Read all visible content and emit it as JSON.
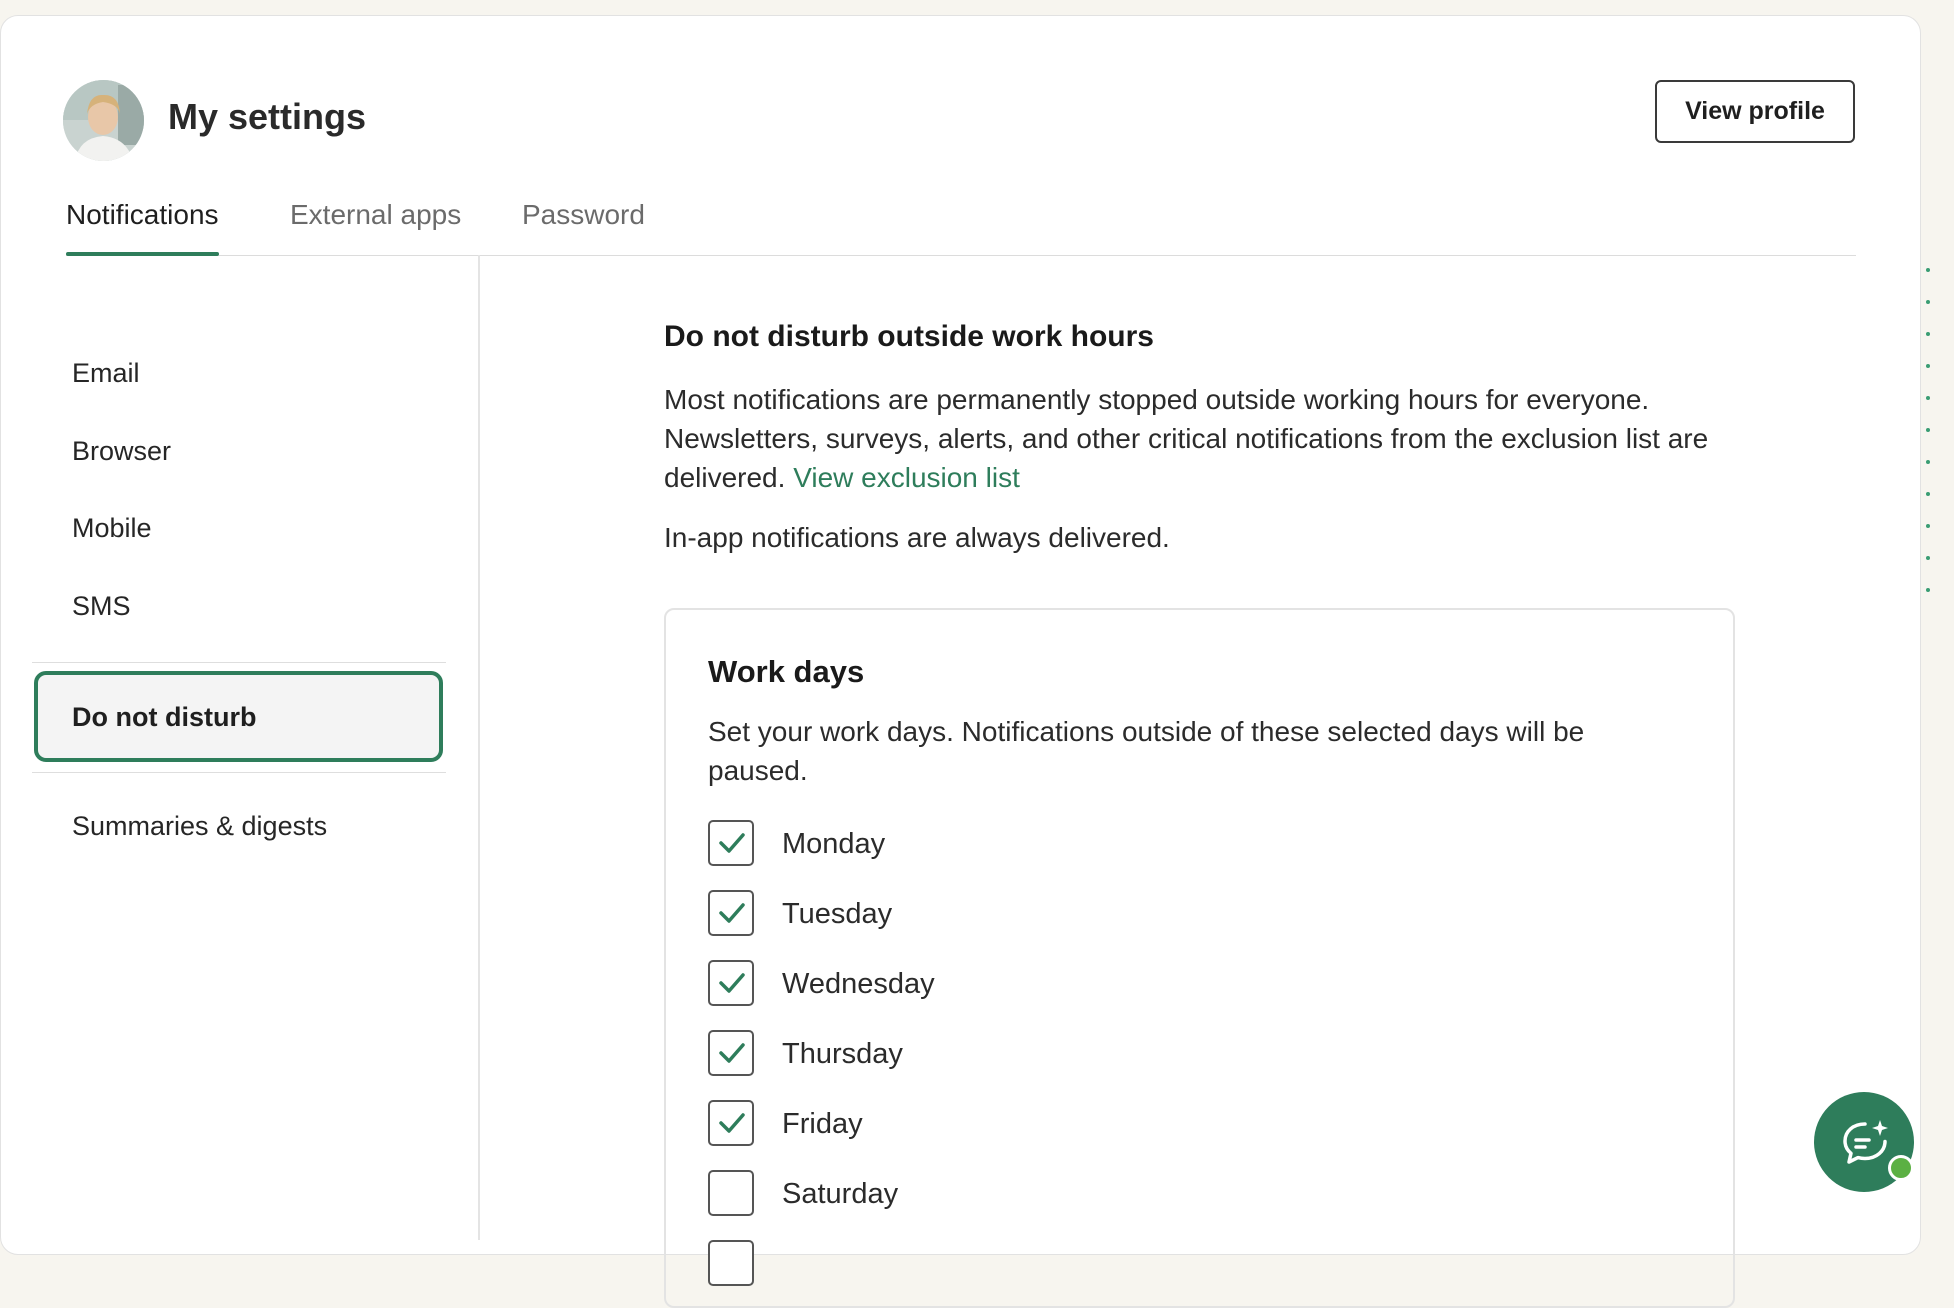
{
  "header": {
    "title": "My settings",
    "view_profile_label": "View profile"
  },
  "tabs": [
    {
      "label": "Notifications",
      "active": true
    },
    {
      "label": "External apps",
      "active": false
    },
    {
      "label": "Password",
      "active": false
    }
  ],
  "sidebar": {
    "items": [
      {
        "label": "Email"
      },
      {
        "label": "Browser"
      },
      {
        "label": "Mobile"
      },
      {
        "label": "SMS"
      },
      {
        "label": "Do not disturb",
        "active": true
      },
      {
        "label": "Summaries & digests"
      }
    ]
  },
  "main": {
    "heading": "Do not disturb outside work hours",
    "description": "Most notifications are permanently stopped outside working hours for everyone. Newsletters, surveys, alerts, and other critical notifications from the exclusion list are delivered.",
    "exclusion_link": "View exclusion list",
    "in_app_note": "In-app notifications are always delivered.",
    "work_days": {
      "title": "Work days",
      "description": "Set your work days. Notifications outside of these selected days will be paused.",
      "days": [
        {
          "label": "Monday",
          "checked": true
        },
        {
          "label": "Tuesday",
          "checked": true
        },
        {
          "label": "Wednesday",
          "checked": true
        },
        {
          "label": "Thursday",
          "checked": true
        },
        {
          "label": "Friday",
          "checked": true
        },
        {
          "label": "Saturday",
          "checked": false
        }
      ]
    }
  },
  "colors": {
    "accent": "#2e7d5b",
    "online": "#5bb043",
    "page_bg": "#f7f5ef"
  },
  "icons": {
    "chat_button": "chat-sparkle-icon",
    "check": "check-icon"
  }
}
